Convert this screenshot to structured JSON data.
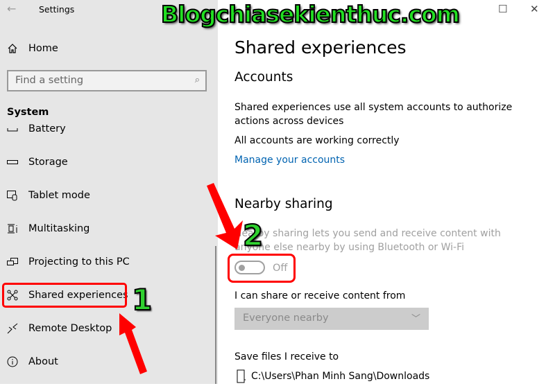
{
  "window": {
    "title": "Settings",
    "back": "←",
    "minimize": "—",
    "maximize": "☐",
    "close": "✕"
  },
  "watermark": "Blogchiasekienthuc.com",
  "sidebar": {
    "home": "Home",
    "search_placeholder": "Find a setting",
    "section": "System",
    "items": [
      {
        "label": "Battery",
        "icon": "battery-icon"
      },
      {
        "label": "Storage",
        "icon": "storage-icon"
      },
      {
        "label": "Tablet mode",
        "icon": "tablet-mode-icon"
      },
      {
        "label": "Multitasking",
        "icon": "multitasking-icon"
      },
      {
        "label": "Projecting to this PC",
        "icon": "projecting-icon"
      },
      {
        "label": "Shared experiences",
        "icon": "shared-experiences-icon"
      },
      {
        "label": "Remote Desktop",
        "icon": "remote-desktop-icon"
      },
      {
        "label": "About",
        "icon": "info-icon"
      }
    ]
  },
  "main": {
    "title": "Shared experiences",
    "accounts": {
      "heading": "Accounts",
      "desc": "Shared experiences use all system accounts to authorize actions across devices",
      "status": "All accounts are working correctly",
      "link": "Manage your accounts"
    },
    "nearby": {
      "heading": "Nearby sharing",
      "desc": "Nearby sharing lets you send and receive content with anyone else nearby by using Bluetooth or Wi-Fi",
      "toggle_state": "Off",
      "share_label": "I can share or receive content from",
      "share_value": "Everyone nearby",
      "save_label": "Save files I receive to",
      "save_path": "C:\\Users\\Phan Minh Sang\\Downloads"
    }
  },
  "annotations": {
    "step1": "1",
    "step2": "2",
    "color": "#ff0000"
  }
}
